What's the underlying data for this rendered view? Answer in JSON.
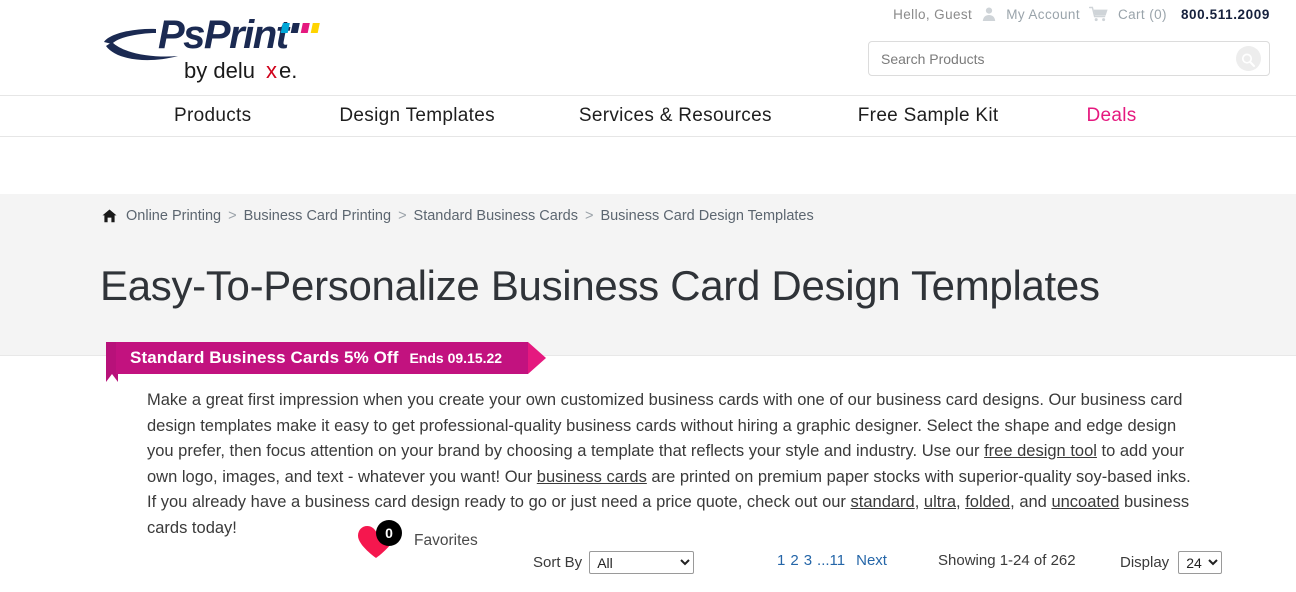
{
  "header": {
    "logo": {
      "brand": "PsPrint",
      "tagline_prefix": "by delu",
      "tagline_x": "x",
      "tagline_suffix": "e."
    },
    "greeting": "Hello, Guest",
    "account_label": "My Account",
    "cart_label": "Cart (0)",
    "phone": "800.511.2009",
    "account_icon": "person-icon",
    "cart_icon": "shopping-cart-icon",
    "search": {
      "placeholder": "Search Products",
      "value": "",
      "button_icon": "search-icon"
    }
  },
  "nav": {
    "items": [
      {
        "label": "Products",
        "accent": false
      },
      {
        "label": "Design Templates",
        "accent": false
      },
      {
        "label": "Services & Resources",
        "accent": false
      },
      {
        "label": "Free Sample Kit",
        "accent": false
      },
      {
        "label": "Deals",
        "accent": true
      }
    ]
  },
  "breadcrumb": {
    "home_icon": "home-icon",
    "separator": ">",
    "items": [
      "Online Printing",
      "Business Card Printing",
      "Standard Business Cards",
      "Business Card Design Templates"
    ]
  },
  "page": {
    "title": "Easy-To-Personalize Business Card Design Templates"
  },
  "promo": {
    "title": "Standard Business Cards 5% Off",
    "ends": "Ends 09.15.22"
  },
  "intro": {
    "p1": "Make a great first impression when you create your own customized business cards with one of our business card designs. Our business card design templates make it easy to get professional-quality business cards without hiring a graphic designer. Select the shape and edge design you prefer, then focus attention on your brand by choosing a template that reflects your style and industry. Use our ",
    "link1": "free design tool",
    "p2": " to add your own logo, images, and text - whatever you want! Our ",
    "link2": "business cards",
    "p3": " are printed on premium paper stocks with superior-quality soy-based inks. If you already have a business card design ready to go or just need a price quote, check out our ",
    "link3": "standard",
    "p4": ", ",
    "link4": "ultra",
    "p5": ", ",
    "link5": "folded",
    "p6": ", and ",
    "link6": "uncoated",
    "p7": " business cards today!"
  },
  "toolbar": {
    "favorites_count": "0",
    "favorites_label": "Favorites",
    "heart_icon": "heart-icon",
    "sort_label": "Sort By",
    "sort_value": "All",
    "sort_options": [
      "All"
    ],
    "pagination": {
      "pages": [
        "1",
        "2",
        "3"
      ],
      "ellipsis": "...11",
      "next_label": "Next"
    },
    "showing": "Showing 1-24 of 262",
    "display_label": "Display",
    "display_value": "24",
    "display_options": [
      "24"
    ]
  },
  "colors": {
    "accent_pink": "#e5197f",
    "promo_body": "#c2127f",
    "promo_tail": "#b8117a",
    "link_blue": "#2566a8",
    "band_gray": "#f4f4f4",
    "logo_navy": "#1b2a52",
    "heart_red": "#f5174e"
  }
}
